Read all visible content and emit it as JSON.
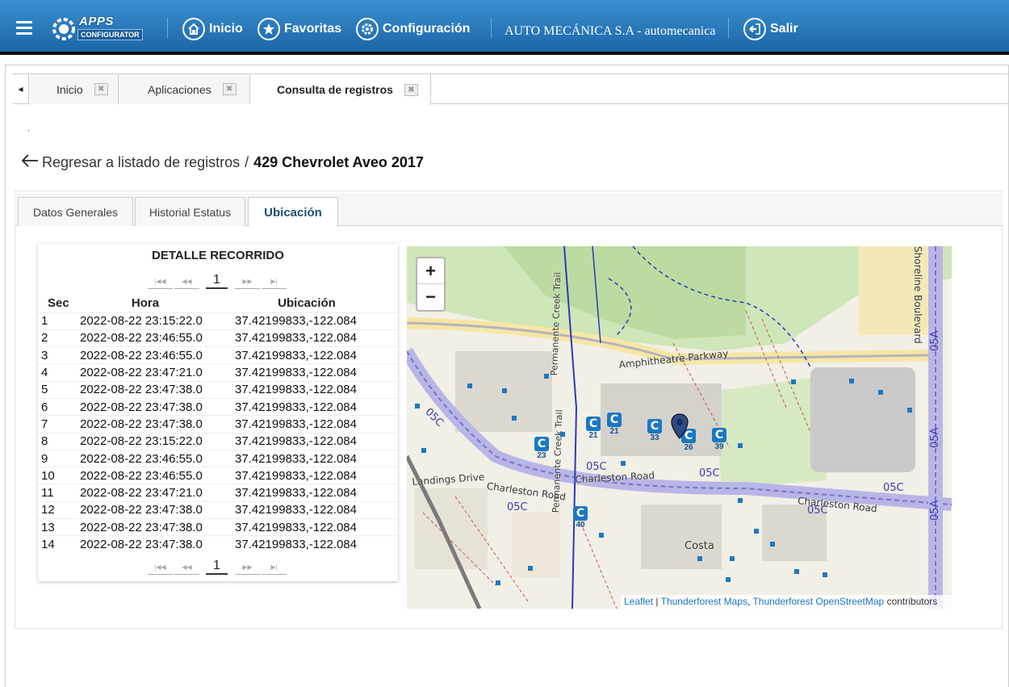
{
  "header": {
    "menu_icon": "hamburger-icon",
    "logo_line1": "APPS",
    "logo_line2": "CONFIGURATOR",
    "nav": [
      {
        "label": "Inicio",
        "icon": "home-icon"
      },
      {
        "label": "Favoritas",
        "icon": "star-icon"
      },
      {
        "label": "Configuración",
        "icon": "gear-icon"
      }
    ],
    "company": "AUTO MECÁNICA S.A - automecanica",
    "logout": {
      "label": "Salir",
      "icon": "logout-icon"
    }
  },
  "tabs": [
    {
      "label": "Inicio",
      "active": false
    },
    {
      "label": "Aplicaciones",
      "active": false
    },
    {
      "label": "Consulta de registros",
      "active": true
    }
  ],
  "stray_mark": ",",
  "breadcrumb": {
    "back_label": "Regresar a listado de registros",
    "separator": "/",
    "current": "429 Chevrolet Aveo 2017"
  },
  "subtabs": [
    {
      "label": "Datos Generales",
      "active": false
    },
    {
      "label": "Historial Estatus",
      "active": false
    },
    {
      "label": "Ubicación",
      "active": true
    }
  ],
  "trip_detail": {
    "title": "DETALLE RECORRIDO",
    "page": "1",
    "columns": [
      "Sec",
      "Hora",
      "Ubicación"
    ],
    "rows": [
      [
        "1",
        "2022-08-22 23:15:22.0",
        "37.42199833,-122.084"
      ],
      [
        "2",
        "2022-08-22 23:46:55.0",
        "37.42199833,-122.084"
      ],
      [
        "3",
        "2022-08-22 23:46:55.0",
        "37.42199833,-122.084"
      ],
      [
        "4",
        "2022-08-22 23:47:21.0",
        "37.42199833,-122.084"
      ],
      [
        "5",
        "2022-08-22 23:47:38.0",
        "37.42199833,-122.084"
      ],
      [
        "6",
        "2022-08-22 23:47:38.0",
        "37.42199833,-122.084"
      ],
      [
        "7",
        "2022-08-22 23:47:38.0",
        "37.42199833,-122.084"
      ],
      [
        "8",
        "2022-08-22 23:15:22.0",
        "37.42199833,-122.084"
      ],
      [
        "9",
        "2022-08-22 23:46:55.0",
        "37.42199833,-122.084"
      ],
      [
        "10",
        "2022-08-22 23:46:55.0",
        "37.42199833,-122.084"
      ],
      [
        "11",
        "2022-08-22 23:47:21.0",
        "37.42199833,-122.084"
      ],
      [
        "12",
        "2022-08-22 23:47:38.0",
        "37.42199833,-122.084"
      ],
      [
        "13",
        "2022-08-22 23:47:38.0",
        "37.42199833,-122.084"
      ],
      [
        "14",
        "2022-08-22 23:47:38.0",
        "37.42199833,-122.084"
      ]
    ]
  },
  "map": {
    "zoom_in": "+",
    "zoom_out": "−",
    "street_labels": [
      "Amphitheatre Parkway",
      "Charleston Road",
      "Charleston Road",
      "Charleston Road",
      "Landings Drive",
      "Permanente Creek Trail",
      "Permanente Creek Trail",
      "Shoreline Boulevard",
      "Costa"
    ],
    "route_labels": [
      "05C",
      "05C",
      "05C",
      "05C",
      "05C",
      "05C",
      "05A",
      "05A",
      "05A"
    ],
    "poi_labels": [
      "21",
      "21",
      "33",
      "26",
      "39",
      "23",
      "40"
    ],
    "attribution": {
      "leaflet": "Leaflet",
      "sep": " | ",
      "tf1": "Thunderforest Maps",
      "comma": ", ",
      "tf2": "Thunderforest",
      "osm": "OpenStreetMap",
      "tail": " contributors"
    }
  }
}
